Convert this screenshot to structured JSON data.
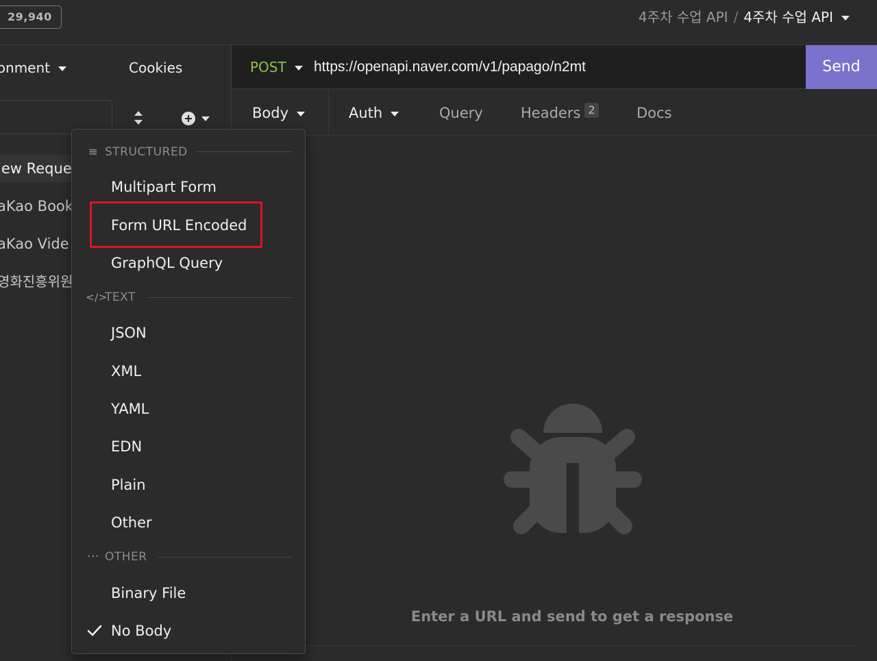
{
  "topbar": {
    "count": "29,940",
    "breadcrumb_parent": "4주차 수업 API",
    "breadcrumb_sep": "/",
    "breadcrumb_current": "4주차 수업 API"
  },
  "sidebar": {
    "environment_label": "ronment",
    "cookies_label": "Cookies",
    "items": [
      {
        "label": "lew Reque"
      },
      {
        "label": "aKao Book"
      },
      {
        "label": "aKao Vide"
      },
      {
        "label": "영화진흥위원"
      }
    ]
  },
  "request": {
    "method": "POST",
    "url": "https://openapi.naver.com/v1/papago/n2mt",
    "send_label": "Send"
  },
  "tabs": {
    "body": "Body",
    "auth": "Auth",
    "query": "Query",
    "headers": "Headers",
    "headers_count": "2",
    "docs": "Docs"
  },
  "response": {
    "empty_message": "Enter a URL and send to get a response"
  },
  "body_menu": {
    "sections": [
      {
        "header": "STRUCTURED",
        "icon": "list-icon",
        "items": [
          "Multipart Form",
          "Form URL Encoded",
          "GraphQL Query"
        ]
      },
      {
        "header": "TEXT",
        "icon": "code-icon",
        "items": [
          "JSON",
          "XML",
          "YAML",
          "EDN",
          "Plain",
          "Other"
        ]
      },
      {
        "header": "OTHER",
        "icon": "ellipsis-icon",
        "items": [
          "Binary File",
          "No Body"
        ]
      }
    ],
    "highlighted_item": "Form URL Encoded",
    "checked_item": "No Body"
  },
  "colors": {
    "method": "#8ec24a",
    "send": "#7a72cc",
    "highlight": "#e0141e"
  }
}
